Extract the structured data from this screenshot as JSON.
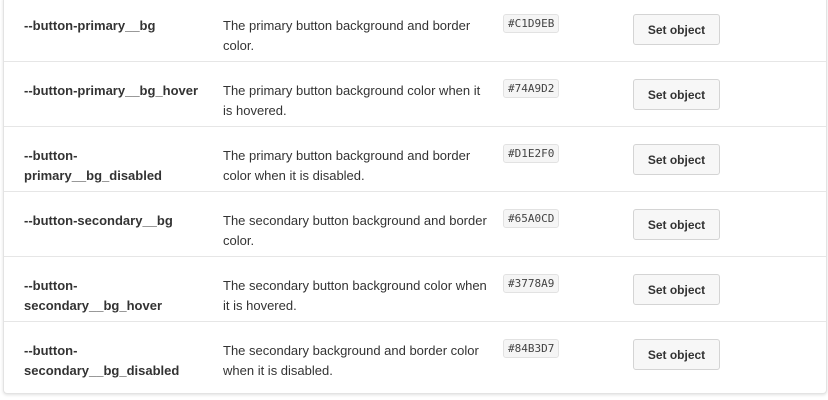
{
  "rows": [
    {
      "name": "--button-primary__bg",
      "description": "The primary button background and border color.",
      "value": "#C1D9EB",
      "action_label": "Set object"
    },
    {
      "name": "--button-primary__bg_hover",
      "description": "The primary button background color when it is hovered.",
      "value": "#74A9D2",
      "action_label": "Set object"
    },
    {
      "name": "--button-primary__bg_disabled",
      "description": "The primary button background and border color when it is disabled.",
      "value": "#D1E2F0",
      "action_label": "Set object"
    },
    {
      "name": "--button-secondary__bg",
      "description": "The secondary button background and border color.",
      "value": "#65A0CD",
      "action_label": "Set object"
    },
    {
      "name": "--button-secondary__bg_hover",
      "description": "The secondary button background color when it is hovered.",
      "value": "#3778A9",
      "action_label": "Set object"
    },
    {
      "name": "--button-secondary__bg_disabled",
      "description": "The secondary background and border color when it is disabled.",
      "value": "#84B3D7",
      "action_label": "Set object"
    }
  ]
}
